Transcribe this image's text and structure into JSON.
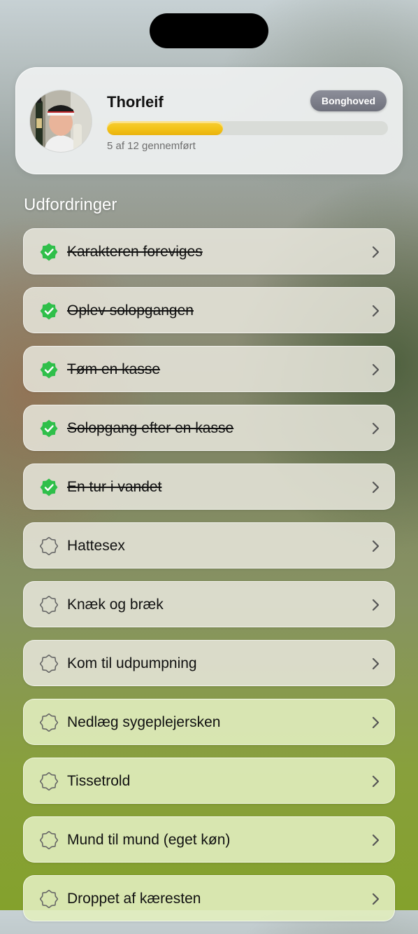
{
  "profile": {
    "name": "Thorleif",
    "badge": "Bonghoved",
    "progress_text": "5 af 12 gennemført",
    "completed": 5,
    "total": 12
  },
  "section_title": "Udfordringer",
  "colors": {
    "check_green": "#2fbf4a",
    "progress_yellow": "#f4c61c",
    "badge_gray": "#7e808b"
  },
  "icons": {
    "done": "check-seal-icon",
    "pending": "seal-outline-icon",
    "chevron": "chevron-right-icon"
  },
  "challenges": [
    {
      "title": "Karakteren foreviges",
      "done": true
    },
    {
      "title": "Oplev solopgangen",
      "done": true
    },
    {
      "title": "Tøm en kasse",
      "done": true
    },
    {
      "title": "Solopgang efter en kasse",
      "done": true
    },
    {
      "title": "En tur i vandet",
      "done": true
    },
    {
      "title": "Hattesex",
      "done": false
    },
    {
      "title": "Knæk og bræk",
      "done": false
    },
    {
      "title": "Kom til udpumpning",
      "done": false
    },
    {
      "title": "Nedlæg sygeplejersken",
      "done": false
    },
    {
      "title": "Tissetrold",
      "done": false
    },
    {
      "title": "Mund til mund (eget køn)",
      "done": false
    },
    {
      "title": "Droppet af kæresten",
      "done": false
    }
  ]
}
